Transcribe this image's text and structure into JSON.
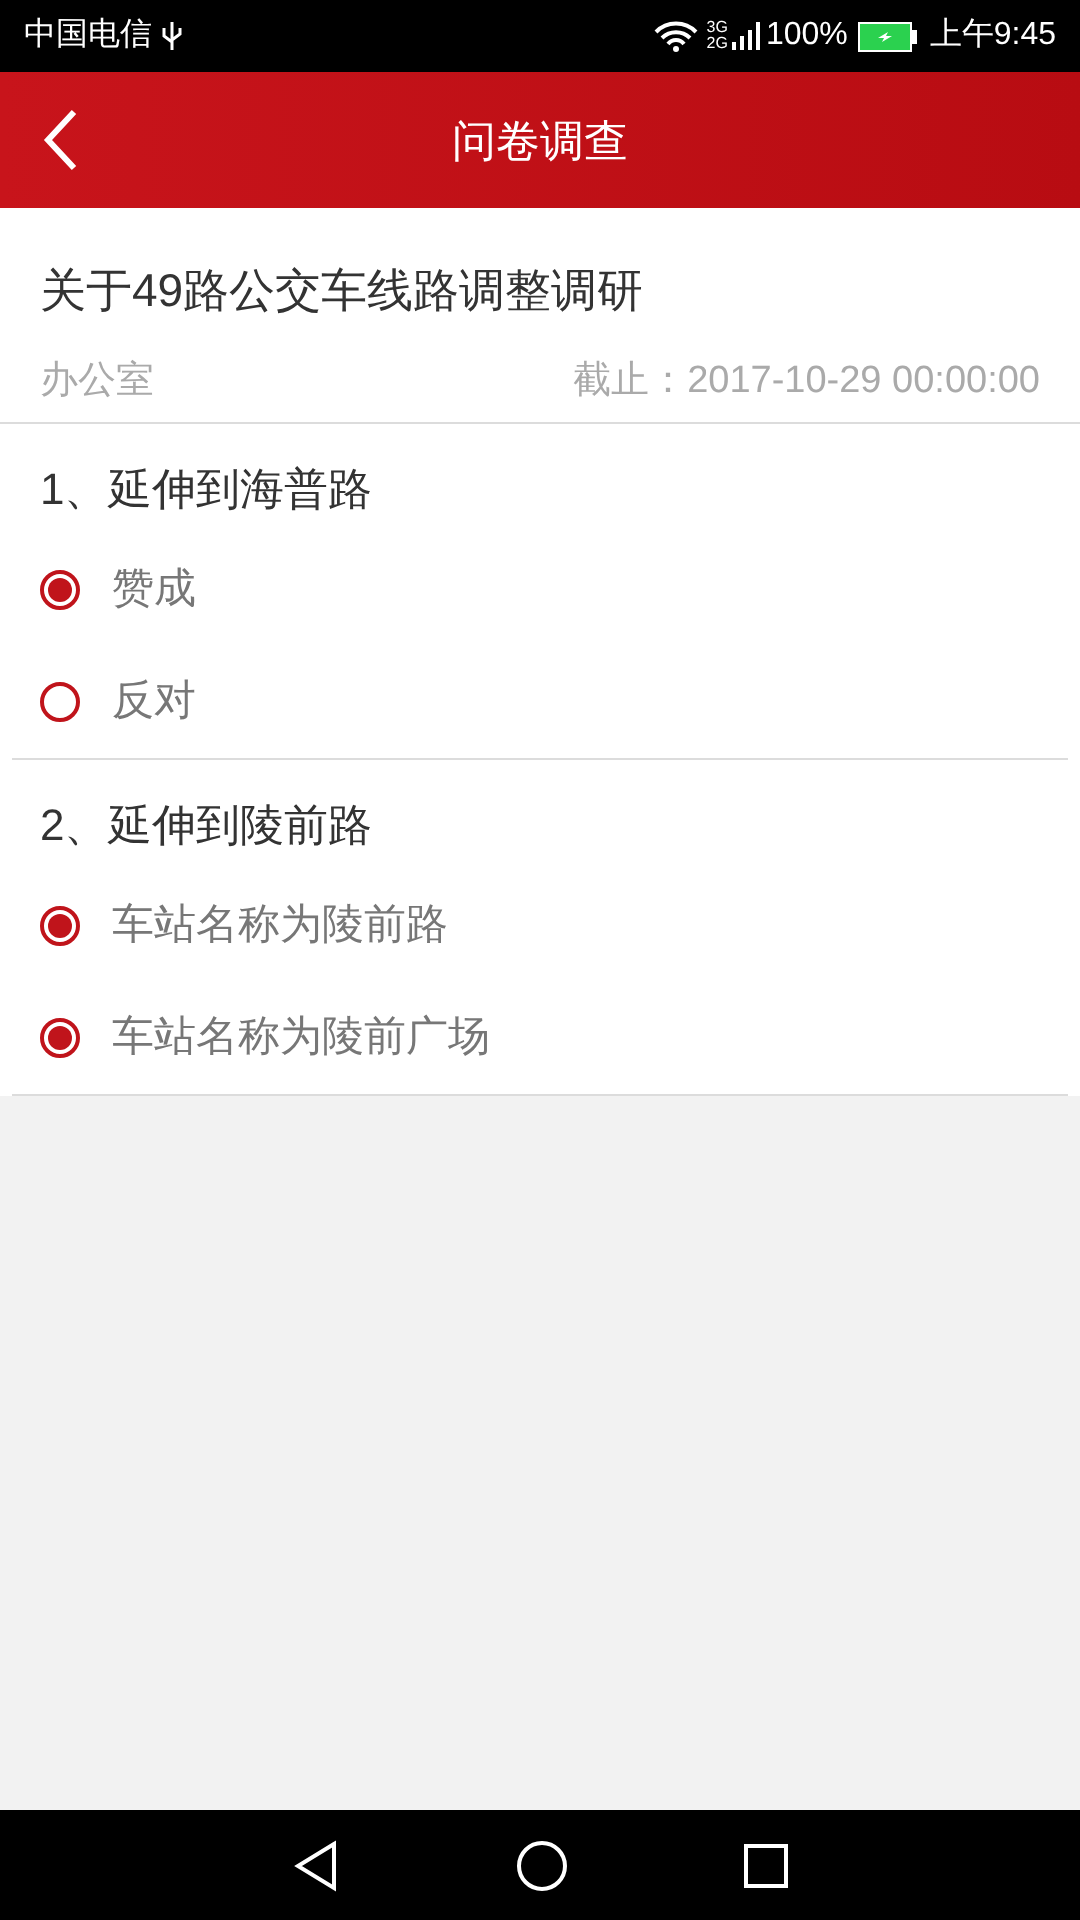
{
  "status_bar": {
    "carrier": "中国电信",
    "network_top": "3G",
    "network_bottom": "2G",
    "battery": "100%",
    "time": "上午9:45"
  },
  "header": {
    "title": "问卷调查"
  },
  "survey": {
    "title": "关于49路公交车线路调整调研",
    "department": "办公室",
    "deadline": "截止：2017-10-29 00:00:00"
  },
  "questions": [
    {
      "title": "1、延伸到海普路",
      "options": [
        {
          "label": "赞成",
          "selected": true
        },
        {
          "label": "反对",
          "selected": false
        }
      ]
    },
    {
      "title": "2、延伸到陵前路",
      "options": [
        {
          "label": "车站名称为陵前路",
          "selected": true
        },
        {
          "label": "车站名称为陵前广场",
          "selected": true
        }
      ]
    }
  ]
}
